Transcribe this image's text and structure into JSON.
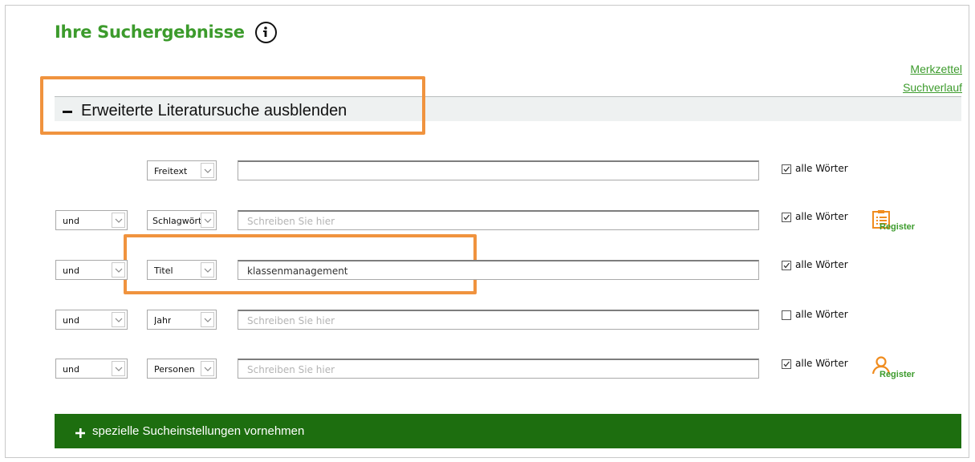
{
  "page": {
    "title": "Ihre Suchergebnisse",
    "info_icon": "info-circle-icon"
  },
  "links": {
    "merkzettel": "Merkzettel",
    "suchverlauf": "Suchverlauf"
  },
  "collapse_bar": {
    "label": "Erweiterte Literatursuche ausblenden",
    "icon": "minus-icon"
  },
  "search_rows": [
    {
      "operator": "",
      "field": "Freitext",
      "input_value": "",
      "placeholder": "",
      "checkbox_label": "alle Wörter",
      "checked": true,
      "register": ""
    },
    {
      "operator": "und",
      "field": "Schlagwört",
      "input_value": "",
      "placeholder": "Schreiben Sie hier",
      "checkbox_label": "alle Wörter",
      "checked": true,
      "register": "Register"
    },
    {
      "operator": "und",
      "field": "Titel",
      "input_value": "klassenmanagement",
      "placeholder": "",
      "checkbox_label": "alle Wörter",
      "checked": true,
      "register": ""
    },
    {
      "operator": "und",
      "field": "Jahr",
      "input_value": "",
      "placeholder": "Schreiben Sie hier",
      "checkbox_label": "alle Wörter",
      "checked": false,
      "register": ""
    },
    {
      "operator": "und",
      "field": "Personen",
      "input_value": "",
      "placeholder": "Schreiben Sie hier",
      "checkbox_label": "alle Wörter",
      "checked": true,
      "register": "Register"
    }
  ],
  "special_settings": {
    "label": "spezielle Sucheinstellungen vornehmen",
    "icon": "plus-icon"
  },
  "colors": {
    "brand_green": "#3c9b2c",
    "dark_green": "#1d6e0f",
    "register_orange": "#f08c1e",
    "highlight_orange": "#f0933e"
  }
}
